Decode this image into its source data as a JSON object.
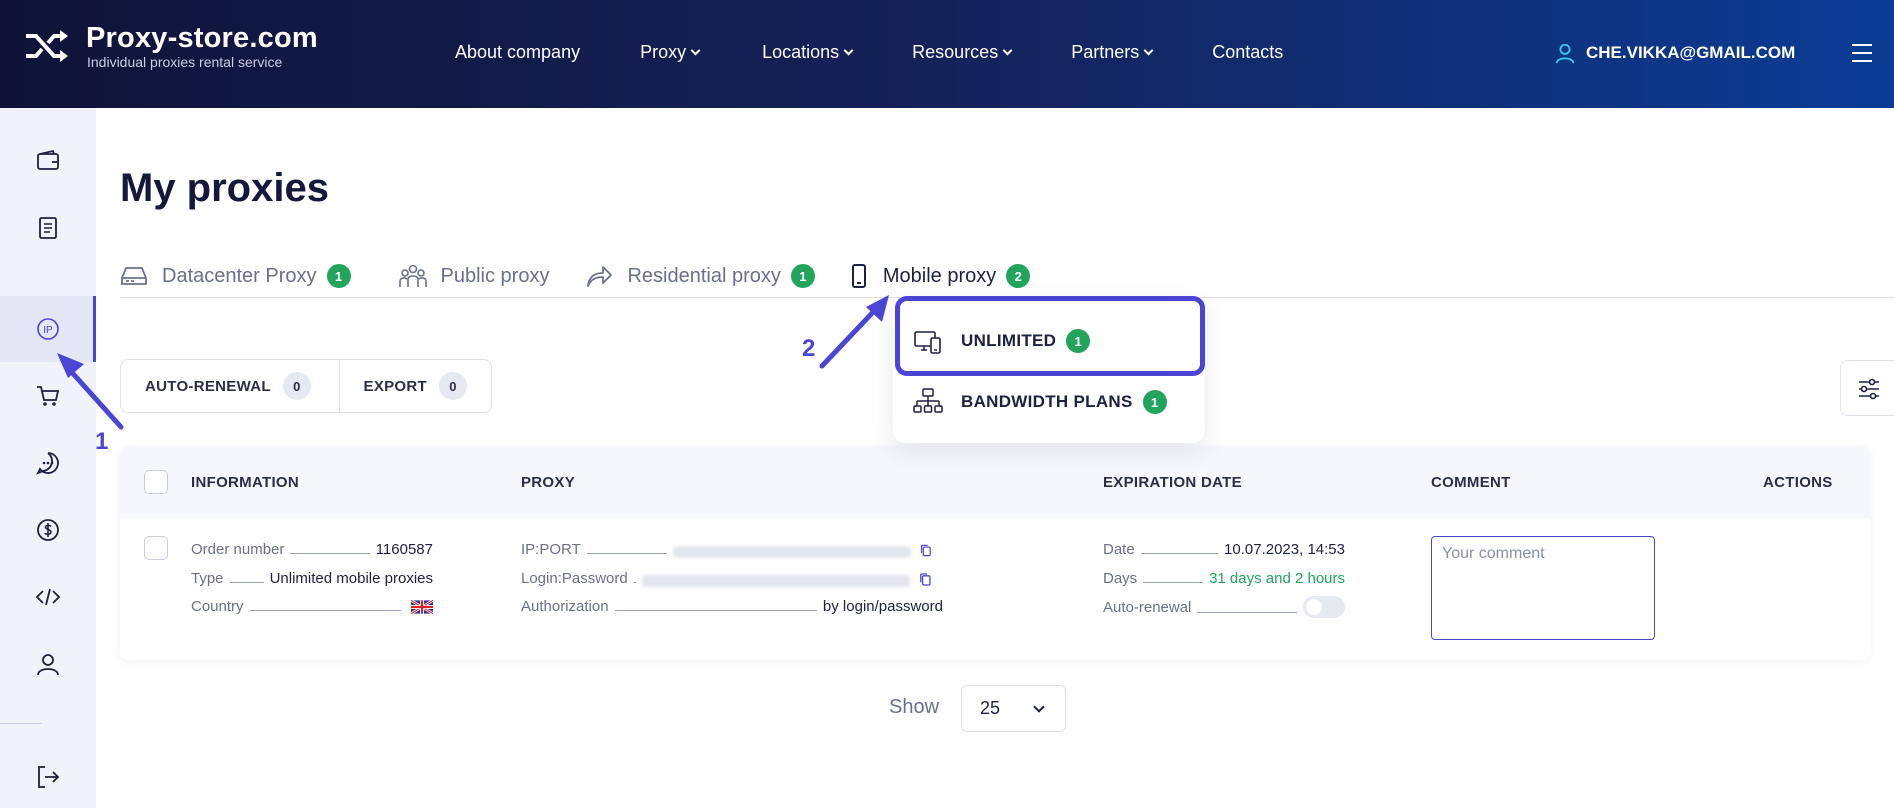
{
  "header": {
    "logo_title": "Proxy-store.com",
    "logo_subtitle": "Individual proxies rental service",
    "nav": [
      {
        "label": "About company",
        "dropdown": false
      },
      {
        "label": "Proxy",
        "dropdown": true
      },
      {
        "label": "Locations",
        "dropdown": true
      },
      {
        "label": "Resources",
        "dropdown": true
      },
      {
        "label": "Partners",
        "dropdown": true
      },
      {
        "label": "Contacts",
        "dropdown": false
      }
    ],
    "user_email": "CHE.VIKKA@GMAIL.COM"
  },
  "sidebar": {
    "items": [
      {
        "icon": "wallet-icon"
      },
      {
        "icon": "document-icon"
      },
      {
        "icon": "ip-icon",
        "label": "IP",
        "active": true
      },
      {
        "icon": "cart-icon"
      },
      {
        "icon": "chat-icon"
      },
      {
        "icon": "dollar-icon"
      },
      {
        "icon": "code-icon"
      },
      {
        "icon": "user-icon"
      },
      {
        "icon": "logout-icon"
      }
    ]
  },
  "page": {
    "title": "My proxies"
  },
  "tabs": [
    {
      "label": "Datacenter Proxy",
      "count": "1",
      "icon": "server-icon"
    },
    {
      "label": "Public proxy",
      "count": "",
      "icon": "people-icon"
    },
    {
      "label": "Residential proxy",
      "count": "1",
      "icon": "share-arrow-icon"
    },
    {
      "label": "Mobile proxy",
      "count": "2",
      "icon": "phone-icon",
      "active": true
    }
  ],
  "mobile_dropdown": [
    {
      "label": "UNLIMITED",
      "count": "1",
      "icon": "devices-icon",
      "highlighted": true
    },
    {
      "label": "BANDWIDTH PLANS",
      "count": "1",
      "icon": "network-icon"
    }
  ],
  "filters": {
    "auto_renewal_label": "AUTO-RENEWAL",
    "auto_renewal_count": "0",
    "export_label": "EXPORT",
    "export_count": "0"
  },
  "table": {
    "columns": [
      "INFORMATION",
      "PROXY",
      "EXPIRATION DATE",
      "COMMENT",
      "ACTIONS"
    ],
    "row": {
      "info": {
        "order_label": "Order number",
        "order_value": "1160587",
        "type_label": "Type",
        "type_value": "Unlimited mobile proxies",
        "country_label": "Country"
      },
      "proxy": {
        "ipport_label": "IP:PORT",
        "login_label": "Login:Password",
        "auth_label": "Authorization",
        "auth_value": "by login/password"
      },
      "expiration": {
        "date_label": "Date",
        "date_value": "10.07.2023, 14:53",
        "days_label": "Days",
        "days_value": "31 days and 2 hours",
        "autorenew_label": "Auto-renewal"
      },
      "comment_placeholder": "Your comment"
    }
  },
  "pagination": {
    "show_label": "Show",
    "per_page": "25"
  },
  "annotations": {
    "step1": "1",
    "step2": "2"
  },
  "colors": {
    "accent": "#4b45d6",
    "badge_green": "#22a45d",
    "header_dark": "#0f1338",
    "header_blue": "#0b3c95"
  }
}
